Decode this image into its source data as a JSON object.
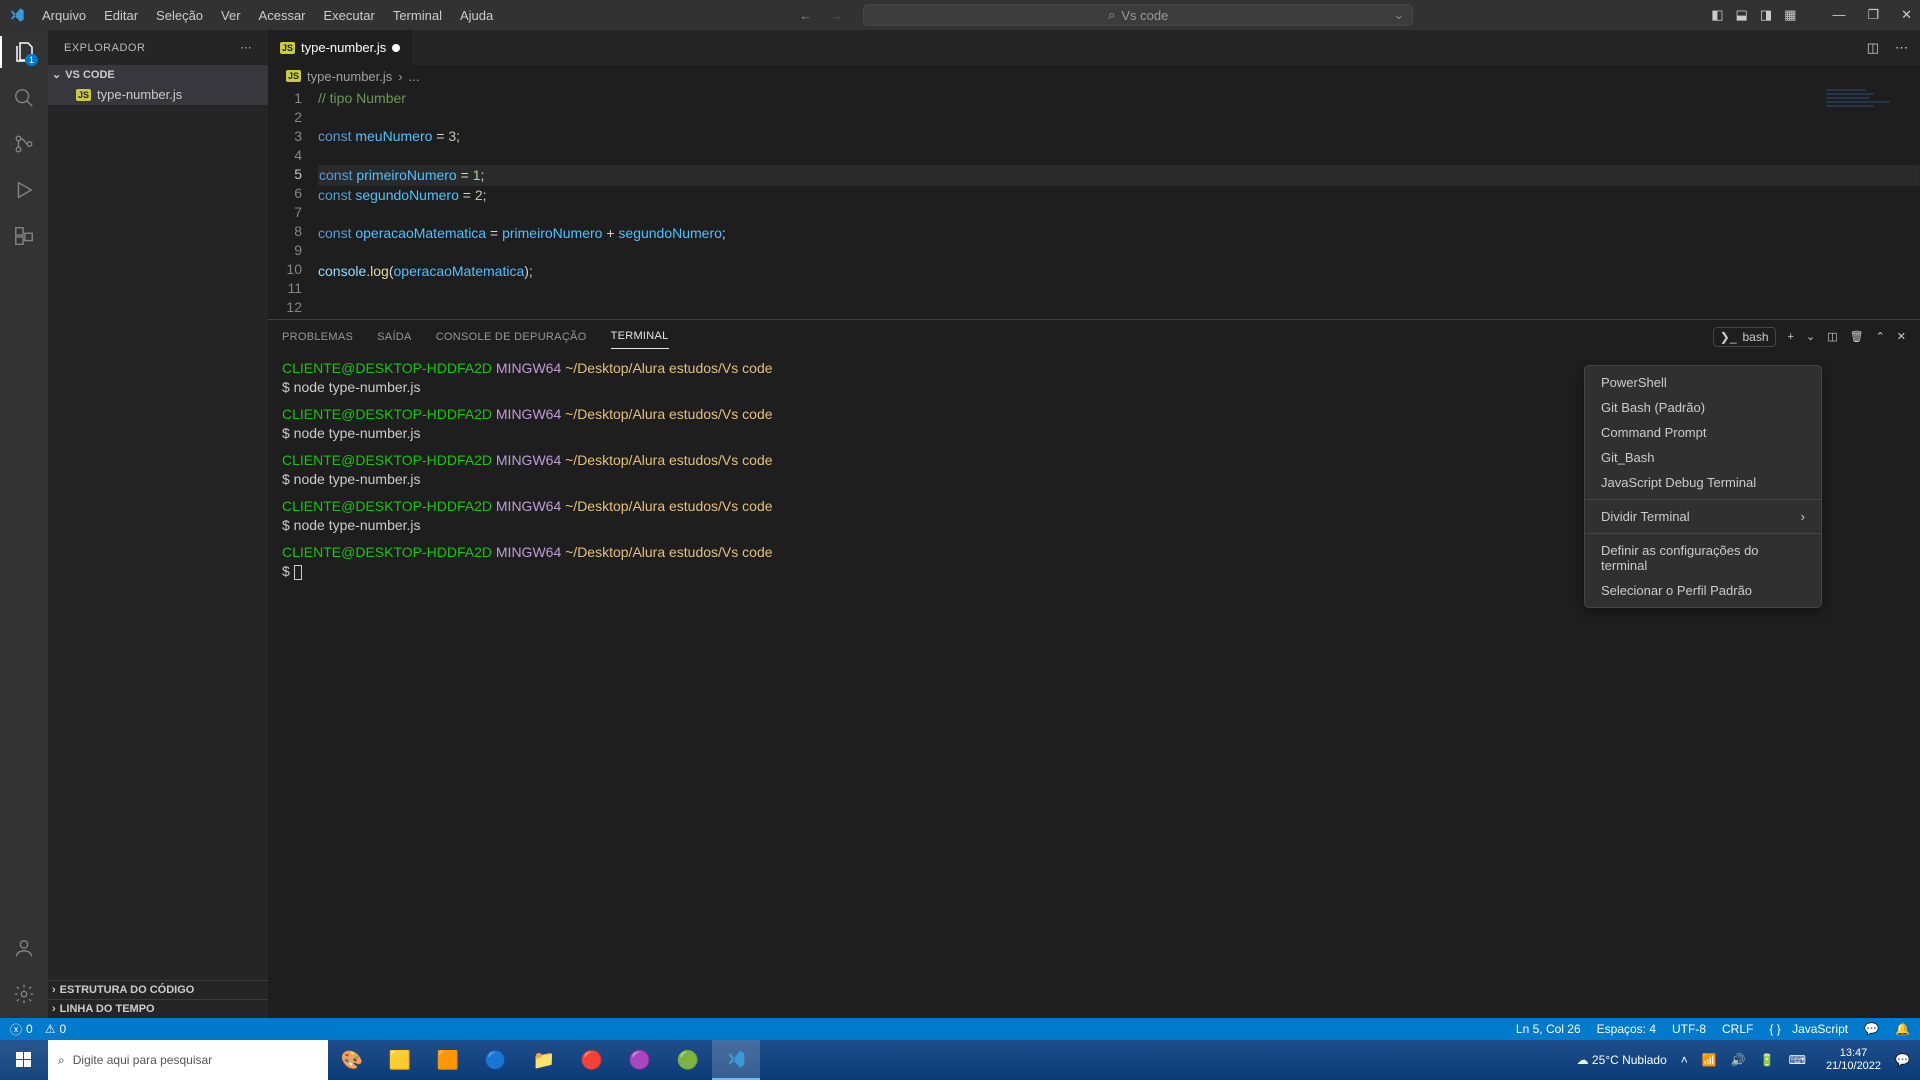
{
  "menu": [
    "Arquivo",
    "Editar",
    "Seleção",
    "Ver",
    "Acessar",
    "Executar",
    "Terminal",
    "Ajuda"
  ],
  "search_placeholder": "Vs code",
  "explorer": {
    "title": "EXPLORADOR",
    "root": "VS CODE",
    "file": "type-number.js",
    "outline": "ESTRUTURA DO CÓDIGO",
    "timeline": "LINHA DO TEMPO"
  },
  "activity_badge": "1",
  "tab": {
    "label": "type-number.js"
  },
  "breadcrumb": {
    "file": "type-number.js",
    "rest": "..."
  },
  "code": {
    "lines": [
      1,
      2,
      3,
      4,
      5,
      6,
      7,
      8,
      9,
      10,
      11,
      12
    ],
    "l1_comment": "// tipo Number",
    "k_const": "const",
    "v_meuNumero": "meuNumero",
    "eq": " = ",
    "n3": "3",
    "semi": ";",
    "v_primeiro": "primeiroNumero",
    "n1": "1",
    "v_segundo": "segundoNumero",
    "n2": "2",
    "v_op": "operacaoMatematica",
    "plus": " + ",
    "console": "console",
    "log": "log",
    "dotl": "(",
    "dotr": ");",
    "dot": "."
  },
  "panel_tabs": {
    "problems": "PROBLEMAS",
    "output": "SAÍDA",
    "debug": "CONSOLE DE DEPURAÇÃO",
    "terminal": "TERMINAL"
  },
  "terminal_badge": "bash",
  "terminal": {
    "user": "CLIENTE@DESKTOP-HDDFA2D",
    "mingw": "MINGW64",
    "path": "~/Desktop/Alura estudos/Vs code",
    "cmd1": "$  node type-number.js",
    "cmd": "$ node type-number.js",
    "prompt": "$ "
  },
  "dropdown": {
    "powershell": "PowerShell",
    "gitbash_default": "Git Bash (Padrão)",
    "cmd": "Command Prompt",
    "gitbash": "Git_Bash",
    "jsdbg": "JavaScript Debug Terminal",
    "split": "Dividir Terminal",
    "settings": "Definir as configurações do terminal",
    "default_profile": "Selecionar o Perfil Padrão"
  },
  "status": {
    "errors": "0",
    "warnings": "0",
    "ln": "Ln 5, Col 26",
    "spaces": "Espaços: 4",
    "enc": "UTF-8",
    "eol": "CRLF",
    "lang": "JavaScript"
  },
  "taskbar": {
    "search": "Digite aqui para pesquisar",
    "weather": "25°C  Nublado",
    "time": "13:47",
    "date": "21/10/2022"
  }
}
